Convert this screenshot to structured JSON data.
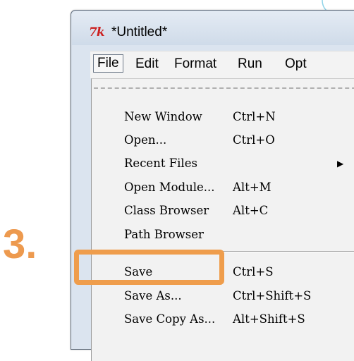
{
  "step_label": "3.",
  "window": {
    "title": "*Untitled*",
    "app_icon": "7k",
    "menubar": {
      "items": [
        {
          "label": "File",
          "active": true
        },
        {
          "label": "Edit"
        },
        {
          "label": "Format"
        },
        {
          "label": "Run"
        },
        {
          "label": "Opt"
        }
      ]
    }
  },
  "file_menu": {
    "items": [
      {
        "label": "New Window",
        "accel": "Ctrl+N"
      },
      {
        "label": "Open...",
        "accel": "Ctrl+O"
      },
      {
        "label": "Recent Files",
        "accel": "",
        "submenu": true
      },
      {
        "label": "Open Module...",
        "accel": "Alt+M"
      },
      {
        "label": "Class Browser",
        "accel": "Alt+C"
      },
      {
        "label": "Path Browser",
        "accel": ""
      },
      {
        "label": "Save",
        "accel": "Ctrl+S",
        "highlighted": true
      },
      {
        "label": "Save As...",
        "accel": "Ctrl+Shift+S"
      },
      {
        "label": "Save Copy As...",
        "accel": "Alt+Shift+S"
      }
    ]
  },
  "colors": {
    "highlight": "#ef9d4c",
    "step_label": "#ed9a4f",
    "app_icon": "#cc1f1f"
  },
  "icons": {
    "submenu_arrow": "triangle-right-icon",
    "app_icon": "tk-feather-icon"
  }
}
